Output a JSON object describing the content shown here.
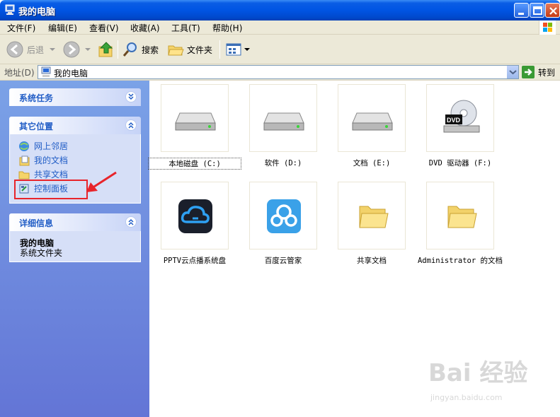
{
  "window": {
    "title": "我的电脑"
  },
  "menu": [
    "文件(F)",
    "编辑(E)",
    "查看(V)",
    "收藏(A)",
    "工具(T)",
    "帮助(H)"
  ],
  "toolbar": {
    "back": "后退",
    "search": "搜索",
    "folders": "文件夹"
  },
  "address": {
    "label": "地址(D)",
    "value": "我的电脑",
    "go": "转到"
  },
  "sidebar": {
    "system_tasks": {
      "title": "系统任务"
    },
    "other_places": {
      "title": "其它位置",
      "links": [
        "网上邻居",
        "我的文档",
        "共享文档",
        "控制面板"
      ]
    },
    "details": {
      "title": "详细信息",
      "name": "我的电脑",
      "desc": "系统文件夹"
    }
  },
  "items": [
    {
      "name": "本地磁盘 (C:)",
      "icon": "hard-drive-icon"
    },
    {
      "name": "软件 (D:)",
      "icon": "hard-drive-icon"
    },
    {
      "name": "文档 (E:)",
      "icon": "hard-drive-icon"
    },
    {
      "name": "DVD 驱动器 (F:)",
      "icon": "dvd-drive-icon"
    },
    {
      "name": "PPTV云点播系统盘",
      "icon": "pptv-cloud-icon"
    },
    {
      "name": "百度云管家",
      "icon": "baidu-cloud-icon"
    },
    {
      "name": "共享文档",
      "icon": "folder-icon"
    },
    {
      "name": "Administrator 的文档",
      "icon": "folder-icon"
    }
  ],
  "watermark": {
    "main": "Bai 经验",
    "sub": "jingyan.baidu.com"
  },
  "colors": {
    "title_bar": "#0054e3",
    "sidebar": "#7ba2e7",
    "link": "#215dc6",
    "highlight": "#e8242b"
  }
}
